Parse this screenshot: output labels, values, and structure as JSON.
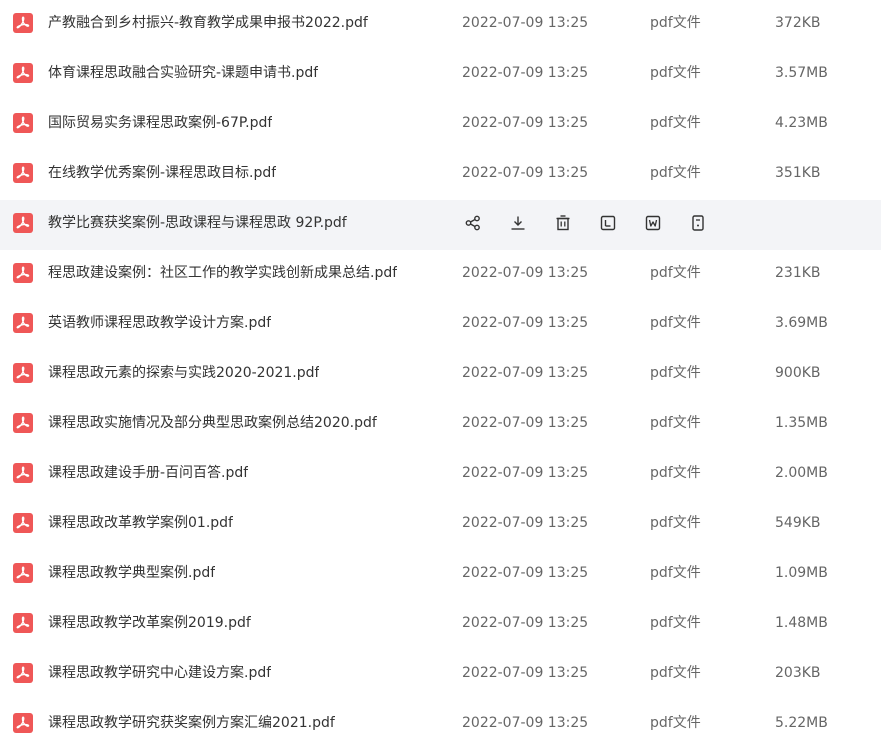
{
  "files": [
    {
      "name": "产教融合到乡村振兴-教育教学成果申报书2022.pdf",
      "date": "2022-07-09 13:25",
      "type": "pdf文件",
      "size": "372KB"
    },
    {
      "name": "体育课程思政融合实验研究-课题申请书.pdf",
      "date": "2022-07-09 13:25",
      "type": "pdf文件",
      "size": "3.57MB"
    },
    {
      "name": "国际贸易实务课程思政案例-67P.pdf",
      "date": "2022-07-09 13:25",
      "type": "pdf文件",
      "size": "4.23MB"
    },
    {
      "name": "在线教学优秀案例-课程思政目标.pdf",
      "date": "2022-07-09 13:25",
      "type": "pdf文件",
      "size": "351KB"
    },
    {
      "name": "教学比赛获奖案例-思政课程与课程思政 92P.pdf",
      "date": "",
      "type": "",
      "size": "",
      "hovered": true
    },
    {
      "name": "程思政建设案例：社区工作的教学实践创新成果总结.pdf",
      "date": "2022-07-09 13:25",
      "type": "pdf文件",
      "size": "231KB"
    },
    {
      "name": "英语教师课程思政教学设计方案.pdf",
      "date": "2022-07-09 13:25",
      "type": "pdf文件",
      "size": "3.69MB"
    },
    {
      "name": "课程思政元素的探索与实践2020-2021.pdf",
      "date": "2022-07-09 13:25",
      "type": "pdf文件",
      "size": "900KB"
    },
    {
      "name": "课程思政实施情况及部分典型思政案例总结2020.pdf",
      "date": "2022-07-09 13:25",
      "type": "pdf文件",
      "size": "1.35MB"
    },
    {
      "name": "课程思政建设手册-百问百答.pdf",
      "date": "2022-07-09 13:25",
      "type": "pdf文件",
      "size": "2.00MB"
    },
    {
      "name": "课程思政改革教学案例01.pdf",
      "date": "2022-07-09 13:25",
      "type": "pdf文件",
      "size": "549KB"
    },
    {
      "name": "课程思政教学典型案例.pdf",
      "date": "2022-07-09 13:25",
      "type": "pdf文件",
      "size": "1.09MB"
    },
    {
      "name": "课程思政教学改革案例2019.pdf",
      "date": "2022-07-09 13:25",
      "type": "pdf文件",
      "size": "1.48MB"
    },
    {
      "name": "课程思政教学研究中心建设方案.pdf",
      "date": "2022-07-09 13:25",
      "type": "pdf文件",
      "size": "203KB"
    },
    {
      "name": "课程思政教学研究获奖案例方案汇编2021.pdf",
      "date": "2022-07-09 13:25",
      "type": "pdf文件",
      "size": "5.22MB"
    }
  ],
  "row_actions": [
    {
      "icon": "share-icon"
    },
    {
      "icon": "download-icon"
    },
    {
      "icon": "trash-icon"
    },
    {
      "icon": "text-extract-icon"
    },
    {
      "icon": "word-convert-icon"
    },
    {
      "icon": "more-file-icon"
    }
  ],
  "colors": {
    "pdf_icon": "#ef5757",
    "hover_row": "#f3f4f7",
    "text_primary": "#333333",
    "text_secondary": "#666666",
    "action_icon": "#333333"
  }
}
